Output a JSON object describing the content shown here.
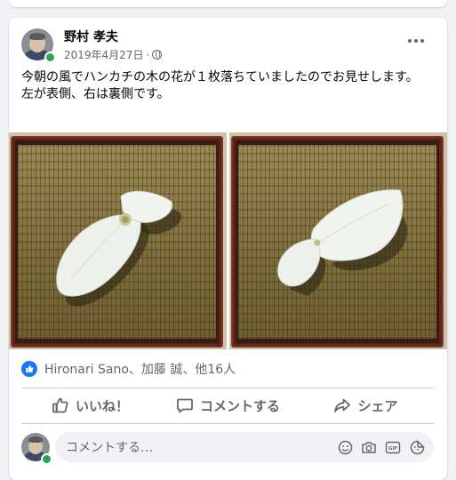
{
  "post": {
    "author": "野村 孝夫",
    "date": "2019年4月27日",
    "separator": "·",
    "privacy_icon": "globe-icon",
    "text": "今朝の風でハンカチの木の花が１枚落ちていましたのでお見せします。\n左が表側、右は裏側です。"
  },
  "photos": [
    {
      "subject": "dove-tree-bract-front",
      "caption": ""
    },
    {
      "subject": "dove-tree-bract-back",
      "caption": ""
    }
  ],
  "reactions": {
    "icon": "like-icon",
    "text": "Hironari Sano、加藤 誠、他16人"
  },
  "actions": {
    "like": "いいね！",
    "comment": "コメントする",
    "share": "シェア"
  },
  "comment_input": {
    "placeholder": "コメントする…",
    "icons": [
      "emoji-icon",
      "camera-icon",
      "gif-icon",
      "sticker-icon"
    ]
  },
  "colors": {
    "accent": "#1877f2",
    "online": "#31a24c",
    "secondary_text": "#65676b"
  }
}
